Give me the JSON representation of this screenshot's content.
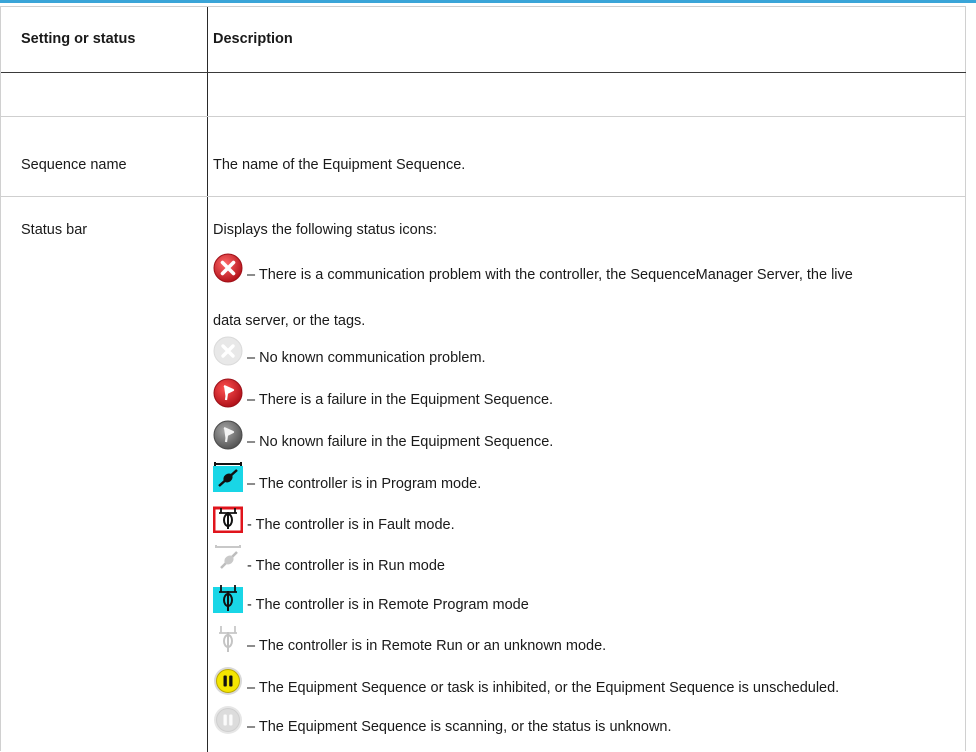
{
  "table": {
    "header": {
      "col1": "Setting or status",
      "col2": "Description"
    },
    "rows": [
      {
        "setting": "Sequence name",
        "description": "The name of the Equipment Sequence."
      },
      {
        "setting": "Status bar",
        "description": "Displays the following status icons:"
      }
    ],
    "status_icons": [
      {
        "icon": "communication-error-icon",
        "text": "– There is a communication problem with the controller, the SequenceManager Server, the live",
        "text_cont": "data server, or the tags."
      },
      {
        "icon": "communication-ok-icon",
        "text": "– No known communication problem."
      },
      {
        "icon": "failure-flag-red-icon",
        "text": "– There is a failure in the Equipment Sequence."
      },
      {
        "icon": "failure-flag-gray-icon",
        "text": "– No known failure in the Equipment Sequence."
      },
      {
        "icon": "program-mode-icon",
        "text": "– The controller is in Program mode."
      },
      {
        "icon": "fault-mode-icon",
        "text": "- The controller is in Fault mode."
      },
      {
        "icon": "run-mode-icon",
        "text": "- The controller is in Run mode"
      },
      {
        "icon": "remote-program-mode-icon",
        "text": "- The controller is in Remote Program mode"
      },
      {
        "icon": "remote-run-mode-icon",
        "text": "– The controller is in Remote Run or an unknown mode."
      },
      {
        "icon": "inhibited-pause-yellow-icon",
        "text": "– The Equipment Sequence or task is inhibited, or the Equipment Sequence is unscheduled."
      },
      {
        "icon": "scanning-pause-gray-icon",
        "text": "– The Equipment Sequence is scanning, or the status is unknown."
      }
    ]
  },
  "colors": {
    "accent_bar": "#3aa5d8",
    "error_red": "#d8202a",
    "cyan": "#19d6e6",
    "yellow": "#f4e600"
  }
}
